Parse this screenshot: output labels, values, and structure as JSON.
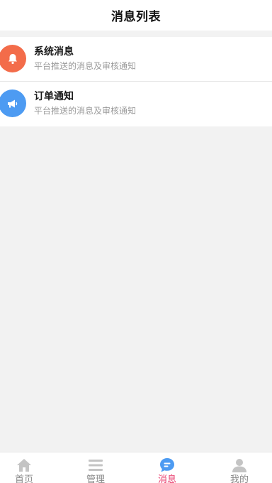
{
  "header": {
    "title": "消息列表"
  },
  "messages": [
    {
      "title": "系统消息",
      "description": "平台推送的消息及审核通知",
      "icon": "bell-icon",
      "icon_color": "#f36c4a"
    },
    {
      "title": "订单通知",
      "description": "平台推送的消息及审核通知",
      "icon": "megaphone-icon",
      "icon_color": "#4d9bf2"
    }
  ],
  "tabbar": {
    "active_color": "#e83a6b",
    "items": [
      {
        "label": "首页",
        "icon": "home-icon",
        "active": false
      },
      {
        "label": "管理",
        "icon": "list-icon",
        "active": false
      },
      {
        "label": "消息",
        "icon": "chat-icon",
        "active": true
      },
      {
        "label": "我的",
        "icon": "user-icon",
        "active": false
      }
    ]
  }
}
